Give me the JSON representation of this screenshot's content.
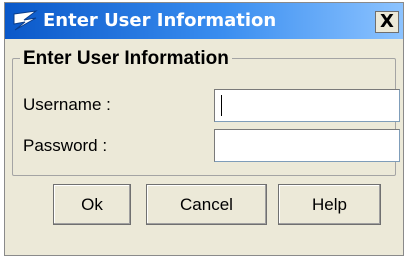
{
  "window": {
    "title": "Enter User Information",
    "close_label": "X"
  },
  "group": {
    "title": "Enter User Information"
  },
  "fields": {
    "username_label": "Username :",
    "username_value": "",
    "password_label": "Password :",
    "password_value": ""
  },
  "buttons": {
    "ok": "Ok",
    "cancel": "Cancel",
    "help": "Help"
  },
  "colors": {
    "titlebar_start": "#0a58c9",
    "titlebar_end": "#8cc3ff",
    "dialog_background": "#ece9d8"
  },
  "icons": {
    "title_icon": "app-logo-icon"
  }
}
